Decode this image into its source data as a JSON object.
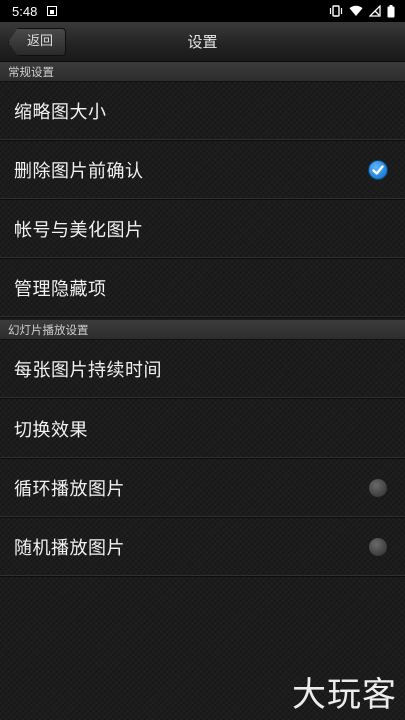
{
  "status_bar": {
    "time": "5:48",
    "icons": [
      "notification-app-icon",
      "vibrate-icon",
      "wifi-icon",
      "no-sim-icon",
      "battery-icon"
    ]
  },
  "header": {
    "back_label": "返回",
    "title": "设置"
  },
  "sections": [
    {
      "title": "常规设置",
      "items": [
        {
          "label": "缩略图大小",
          "control": "none"
        },
        {
          "label": "删除图片前确认",
          "control": "checkbox",
          "checked": true
        },
        {
          "label": "帐号与美化图片",
          "control": "none"
        },
        {
          "label": "管理隐藏项",
          "control": "none"
        }
      ]
    },
    {
      "title": "幻灯片播放设置",
      "items": [
        {
          "label": "每张图片持续时间",
          "control": "none"
        },
        {
          "label": "切换效果",
          "control": "none"
        },
        {
          "label": "循环播放图片",
          "control": "checkbox",
          "checked": false
        },
        {
          "label": "随机播放图片",
          "control": "checkbox",
          "checked": false
        }
      ]
    }
  ],
  "watermark": "大玩客",
  "colors": {
    "background": "#1c1c1c",
    "accent_checked": "#1f7fd6",
    "unchecked": "#4a4a4a",
    "status_bar": "#000000"
  }
}
